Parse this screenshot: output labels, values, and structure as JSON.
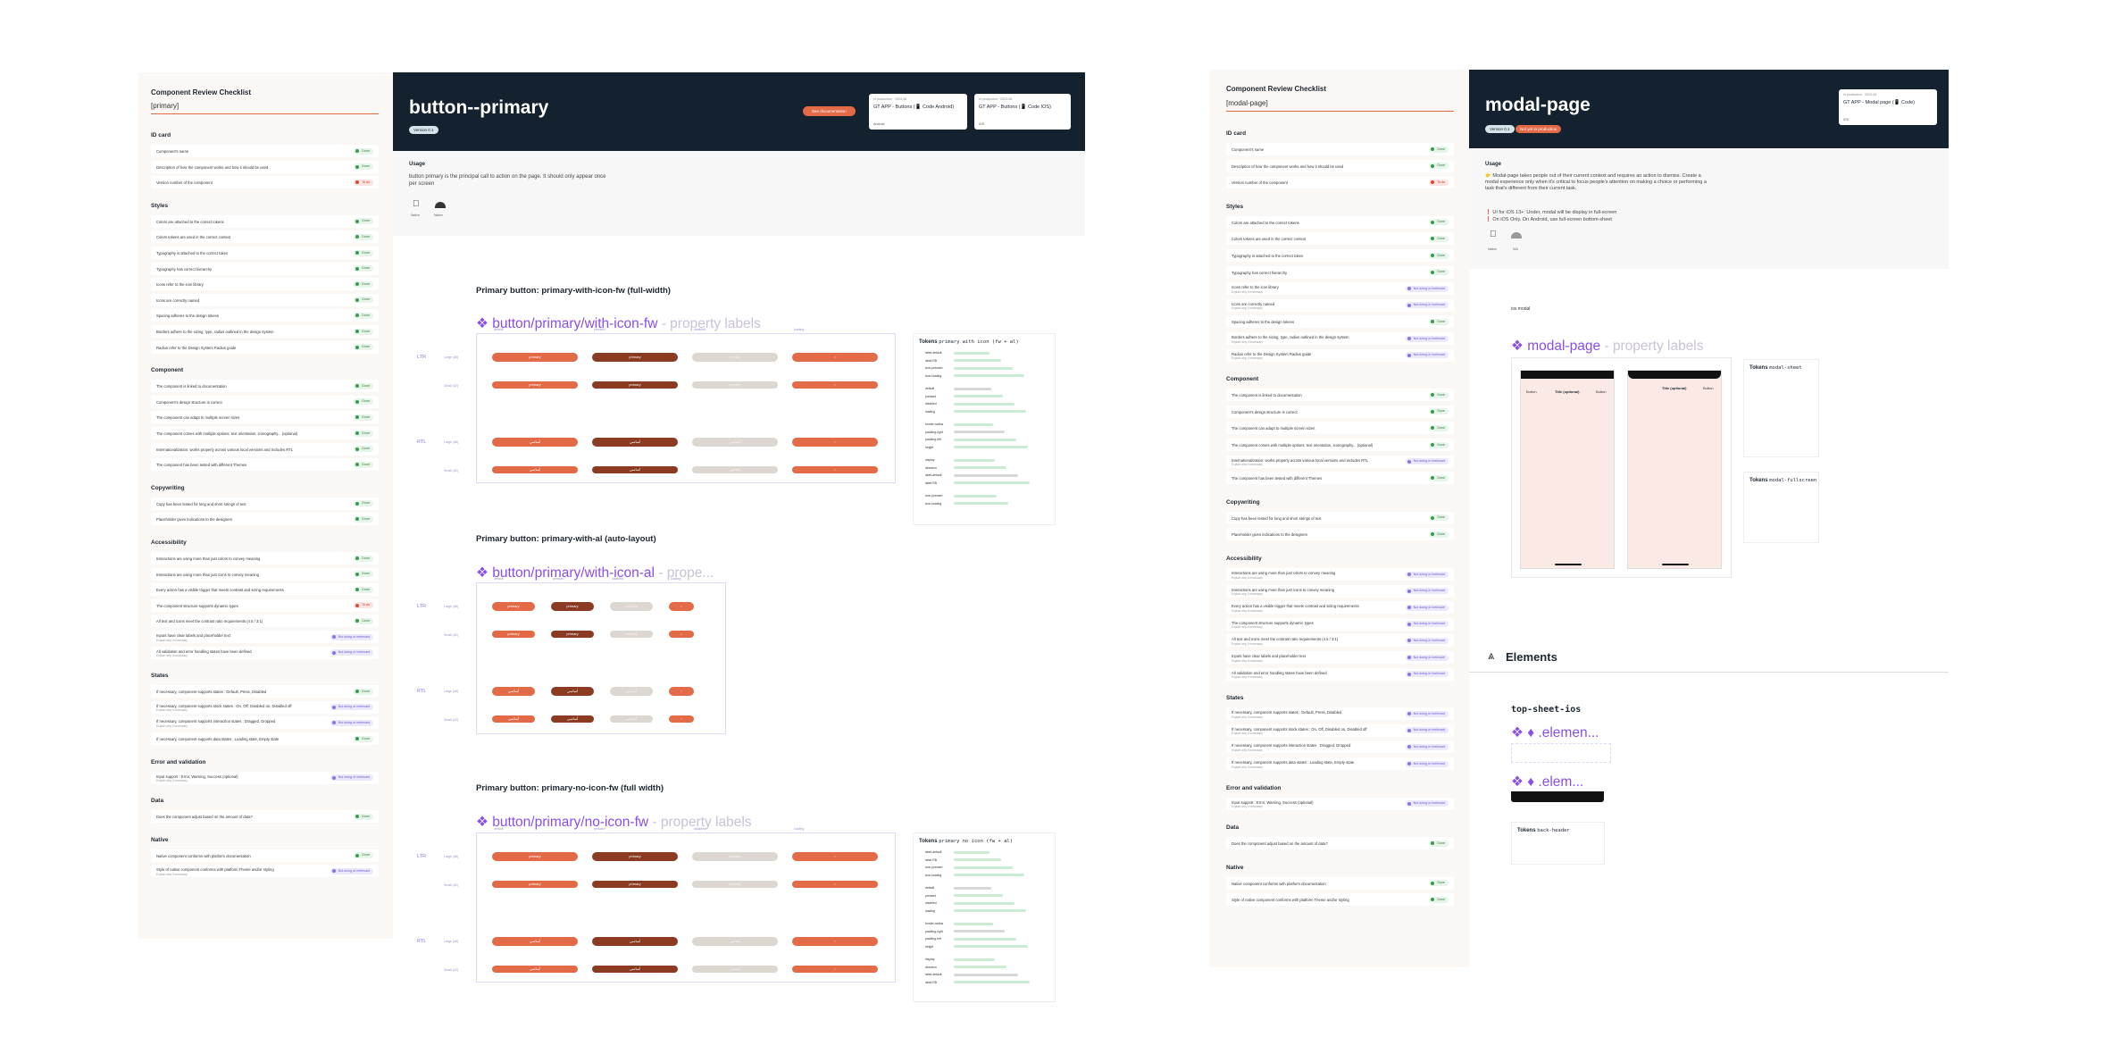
{
  "left_page": {
    "checklist": {
      "title": "Component Review Checklist",
      "subtitle": "[primary]",
      "sections": [
        {
          "name": "ID card",
          "items": [
            {
              "label": "Component's name",
              "status": "Done"
            },
            {
              "label": "Description of how the component works and how it should be used",
              "status": "Done"
            },
            {
              "label": "Version number of the component",
              "status": "To do"
            }
          ]
        },
        {
          "name": "Styles",
          "items": [
            {
              "label": "Colors are attached to the correct tokens",
              "status": "Done"
            },
            {
              "label": "Colors tokens are used in the correct context",
              "status": "Done"
            },
            {
              "label": "Typography is attached to the correct token",
              "status": "Done"
            },
            {
              "label": "Typography has correct hierarchy",
              "status": "Done"
            },
            {
              "label": "Icons refer to the icon library",
              "status": "Done"
            },
            {
              "label": "Icons are correctly named",
              "status": "Done"
            },
            {
              "label": "Spacing adheres to the design tokens",
              "status": "Done"
            },
            {
              "label": "Borders adhere to the sizing, type, radius outlined in the design system",
              "status": "Done"
            },
            {
              "label": "Radius refer to the Design System Radius guide",
              "status": "Done"
            }
          ]
        },
        {
          "name": "Component",
          "items": [
            {
              "label": "The component is linked to documentation",
              "status": "Done"
            },
            {
              "label": "Component's design structure is correct",
              "status": "Done"
            },
            {
              "label": "The component can adapt to multiple screen sizes",
              "status": "Done"
            },
            {
              "label": "The component comes with multiple options: text orientation, iconography... (optional)",
              "status": "Done"
            },
            {
              "label": "Internationalization: works properly across various local versions and includes RTL",
              "status": "Done"
            },
            {
              "label": "The component has been tested with different Themes",
              "status": "Done"
            }
          ]
        },
        {
          "name": "Copywriting",
          "items": [
            {
              "label": "Copy has been tested for long and short strings of text",
              "status": "Done"
            },
            {
              "label": "Placeholder gives indications to the designers",
              "status": "Done"
            }
          ]
        },
        {
          "name": "Accessibility",
          "items": [
            {
              "label": "Interactions are using more than just colors to convey meaning",
              "status": "Done"
            },
            {
              "label": "Interactions are using more than just icons to convey meaning",
              "status": "Done"
            },
            {
              "label": "Every action has a visible trigger that meets contrast and sizing requirements",
              "status": "Done"
            },
            {
              "label": "The component structure supports dynamic types",
              "status": "To do"
            },
            {
              "label": "All text and icons meet the contrast ratio requirements (4.5 / 3:1)",
              "status": "Done"
            },
            {
              "label": "Inputs have clear labels and placeholder text",
              "sub": "Explain why if necessary",
              "status": "Not doing or irrelevant"
            },
            {
              "label": "All validation and error handling states have been defined",
              "sub": "Explain why if necessary",
              "status": "Not doing or irrelevant"
            }
          ]
        },
        {
          "name": "States",
          "items": [
            {
              "label": "If necessary, component supports states : Default, Press, Disabled",
              "status": "Done"
            },
            {
              "label": "If necessary, component supports stock states : On, Off, Disabled on, Disabled off",
              "sub": "Explain why if necessary",
              "status": "Not doing or irrelevant"
            },
            {
              "label": "If necessary, component supports interaction states : Dragged, Dropped",
              "sub": "Explain why if necessary",
              "status": "Not doing or irrelevant"
            },
            {
              "label": "If necessary, component supports data states : Loading state, Empty state",
              "status": "Done"
            }
          ]
        },
        {
          "name": "Error and validation",
          "items": [
            {
              "label": "Input support : Error, Warning, Success (optional)",
              "sub": "Explain why if necessary",
              "status": "Not doing or irrelevant"
            }
          ]
        },
        {
          "name": "Data",
          "items": [
            {
              "label": "Does the component adjust based on the amount of data?",
              "status": "Done"
            }
          ]
        },
        {
          "name": "Native",
          "items": [
            {
              "label": "Native component conforms with platform documentation",
              "status": "Done"
            },
            {
              "label": "Style of native component conforms with platform Theme and/or styling",
              "sub": "Explain why if necessary",
              "status": "Not doing or irrelevant"
            }
          ]
        }
      ]
    },
    "header": {
      "title": "button--primary",
      "version": "Version 0.1",
      "cta": "See documentation",
      "cards": [
        {
          "meta": "In production · 2023-08",
          "name": "GT APP - Buttons (📱 Code Android)",
          "foot": "Android"
        },
        {
          "meta": "In production · 2023-08",
          "name": "GT APP - Buttons (📱 Code IOS)",
          "foot": "iOS"
        }
      ]
    },
    "usage": {
      "heading": "Usage",
      "text": "button primary is the principal call to action on the page. It should only appear once per screen",
      "platform_ios": "Native",
      "platform_android": "Native"
    },
    "sections": [
      {
        "heading": "Primary button: primary-with-icon-fw (full-width)",
        "component": "button/primary/with-icon-fw",
        "suffix": " - property labels",
        "states": [
          "default",
          "pressed",
          "disabled",
          "loading"
        ],
        "rows": [
          "LTR",
          "RTL"
        ],
        "sizes": [
          "Large (48)",
          "Small (32)"
        ],
        "button_text": "primary",
        "button_text_rtl": "أساسي",
        "tokens_title": "Tokens",
        "tokens_name": "primary with icon (fw + al)"
      },
      {
        "heading": "Primary button: primary-with-al (auto-layout)",
        "component": "button/primary/with-icon-al",
        "suffix": " - prope...",
        "states": [
          "default",
          "pressed",
          "disabled",
          "loading"
        ],
        "rows": [
          "LTR",
          "RTL"
        ],
        "sizes": [
          "Large (48)",
          "Small (32)"
        ],
        "button_text": "primary",
        "button_text_rtl": "أساسي"
      },
      {
        "heading": "Primary button: primary-no-icon-fw (full width)",
        "component": "button/primary/no-icon-fw",
        "suffix": " - property labels",
        "states": [
          "default",
          "pressed",
          "disabled",
          "loading"
        ],
        "rows": [
          "LTR",
          "RTL"
        ],
        "sizes": [
          "Large (48)",
          "Small (32)"
        ],
        "button_text": "primary",
        "button_text_rtl": "أساسي",
        "tokens_title": "Tokens",
        "tokens_name": "primary no icon (fw + al)"
      }
    ],
    "token_groups": [
      "text",
      "primary/label",
      "icon",
      "container",
      "primary/button"
    ],
    "token_keys": [
      "label-default",
      "label-RB",
      "icon-pressed",
      "icon-loading",
      "default",
      "pressed",
      "disabled",
      "loading",
      "border-radius",
      "padding-right",
      "padding-left",
      "height",
      "display",
      "direction"
    ]
  },
  "right_page": {
    "checklist": {
      "title": "Component Review Checklist",
      "subtitle": "[modal-page]",
      "sections": [
        {
          "name": "ID card",
          "items": [
            {
              "label": "Component's name",
              "status": "Done"
            },
            {
              "label": "Description of how the component works and how it should be used",
              "status": "Done"
            },
            {
              "label": "Version number of the component",
              "status": "To do"
            }
          ]
        },
        {
          "name": "Styles",
          "items": [
            {
              "label": "Colors are attached to the correct tokens",
              "status": "Done"
            },
            {
              "label": "Colors tokens are used in the correct context",
              "status": "Done"
            },
            {
              "label": "Typography is attached to the correct token",
              "status": "Done"
            },
            {
              "label": "Typography has correct hierarchy",
              "status": "Done"
            },
            {
              "label": "Icons refer to the icon library",
              "sub": "Explain why if necessary",
              "status": "Not doing or irrelevant"
            },
            {
              "label": "Icons are correctly named",
              "sub": "Explain why if necessary",
              "status": "Not doing or irrelevant"
            },
            {
              "label": "Spacing adheres to the design tokens",
              "status": "Done"
            },
            {
              "label": "Borders adhere to the sizing, type, radius outlined in the design system",
              "sub": "Explain why if necessary",
              "status": "Not doing or irrelevant"
            },
            {
              "label": "Radius refer to the Design System Radius guide",
              "sub": "Explain why if necessary",
              "status": "Not doing or irrelevant"
            }
          ]
        },
        {
          "name": "Component",
          "items": [
            {
              "label": "The component is linked to documentation",
              "status": "Done"
            },
            {
              "label": "Component's design structure is correct",
              "status": "Done"
            },
            {
              "label": "The component can adapt to multiple screen sizes",
              "status": "Done"
            },
            {
              "label": "The component comes with multiple options: text orientation, iconography... (optional)",
              "status": "Done"
            },
            {
              "label": "Internationalization: works properly across various local versions and includes RTL",
              "sub": "Explain why if necessary",
              "status": "Not doing or irrelevant"
            },
            {
              "label": "The component has been tested with different Themes",
              "status": "Done"
            }
          ]
        },
        {
          "name": "Copywriting",
          "items": [
            {
              "label": "Copy has been tested for long and short strings of text",
              "status": "Done"
            },
            {
              "label": "Placeholder gives indications to the designers",
              "status": "Done"
            }
          ]
        },
        {
          "name": "Accessibility",
          "items": [
            {
              "label": "Interactions are using more than just colors to convey meaning",
              "sub": "Explain why if necessary",
              "status": "Not doing or irrelevant"
            },
            {
              "label": "Interactions are using more than just icons to convey meaning",
              "sub": "Explain why if necessary",
              "status": "Not doing or irrelevant"
            },
            {
              "label": "Every action has a visible trigger that meets contrast and sizing requirements",
              "sub": "Explain why if necessary",
              "status": "Not doing or irrelevant"
            },
            {
              "label": "The component structure supports dynamic types",
              "sub": "Explain why if necessary",
              "status": "Not doing or irrelevant"
            },
            {
              "label": "All text and icons meet the contrast ratio requirements (4.5 / 3:1)",
              "sub": "Explain why if necessary",
              "status": "Not doing or irrelevant"
            },
            {
              "label": "Inputs have clear labels and placeholder text",
              "sub": "Explain why if necessary",
              "status": "Not doing or irrelevant"
            },
            {
              "label": "All validation and error handling states have been defined",
              "sub": "Explain why if necessary",
              "status": "Not doing or irrelevant"
            }
          ]
        },
        {
          "name": "States",
          "items": [
            {
              "label": "If necessary, component supports states : Default, Press, Disabled",
              "sub": "Explain why if necessary",
              "status": "Not doing or irrelevant"
            },
            {
              "label": "If necessary, component supports stock states : On, Off, Disabled on, Disabled off",
              "sub": "Explain why if necessary",
              "status": "Not doing or irrelevant"
            },
            {
              "label": "If necessary, component supports interaction states : Dragged, Dropped",
              "sub": "Explain why if necessary",
              "status": "Not doing or irrelevant"
            },
            {
              "label": "If necessary, component supports data states : Loading state, Empty state",
              "sub": "Explain why if necessary",
              "status": "Not doing or irrelevant"
            }
          ]
        },
        {
          "name": "Error and validation",
          "items": [
            {
              "label": "Input support : Error, Warning, Success (optional)",
              "sub": "Explain why if necessary",
              "status": "Not doing or irrelevant"
            }
          ]
        },
        {
          "name": "Data",
          "items": [
            {
              "label": "Does the component adjust based on the amount of data?",
              "status": "Done"
            }
          ]
        },
        {
          "name": "Native",
          "items": [
            {
              "label": "Native component conforms with platform documentation",
              "status": "Done"
            },
            {
              "label": "Style of native component conforms with platform Theme and/or styling",
              "status": "Done"
            }
          ]
        }
      ]
    },
    "header": {
      "title": "modal-page",
      "version": "Version 0.1",
      "status": "Not yet in production",
      "card": {
        "meta": "In production · 2023-08",
        "name": "GT APP - Modal page (📱 Code)",
        "foot": "iOS"
      }
    },
    "usage": {
      "heading": "Usage",
      "text1": "👉 Modal-page takes people out of their current context and requires an action to dismiss. Create a modal experience only when it's critical to focus people's attention on making a choice or performing a task that's different from their current task.",
      "text2": "❗ UI for iOS 13+: Under, modal will be display in full-screen",
      "text3": "❗ On iOS Only. On Android, use full-screen bottom-sheet",
      "platform_ios": "Native",
      "platform_android": "N/A"
    },
    "ios_label": "ios modal",
    "component": "modal-page",
    "suffix": " - property labels",
    "phones": [
      {
        "title": "Title (optional)",
        "left": "Button",
        "right": "Button"
      },
      {
        "title": "Title (optional)",
        "left": "",
        "right": "Button"
      }
    ],
    "tokens": [
      {
        "title": "Tokens",
        "name": "modal-sheet",
        "groups": [
          "top-sheet",
          "bar-item",
          "nav-bar",
          "bar-item"
        ]
      },
      {
        "title": "Tokens",
        "name": "modal-fullscreen",
        "groups": [
          "top-sheet",
          "bar-item",
          "nav-bar"
        ]
      }
    ],
    "elements": {
      "heading": "Elements",
      "group_label": "top-sheet-ios",
      "comp1": ".elemen...",
      "comp2": ".elem...",
      "tokens_title": "Tokens",
      "tokens_name": "back-header"
    }
  },
  "colors": {
    "primary": "#e36a47",
    "pressed": "#8a3b22",
    "disabled": "#dcd7d0",
    "header_bg": "#13222e",
    "component_purple": "#8a4fe8"
  }
}
